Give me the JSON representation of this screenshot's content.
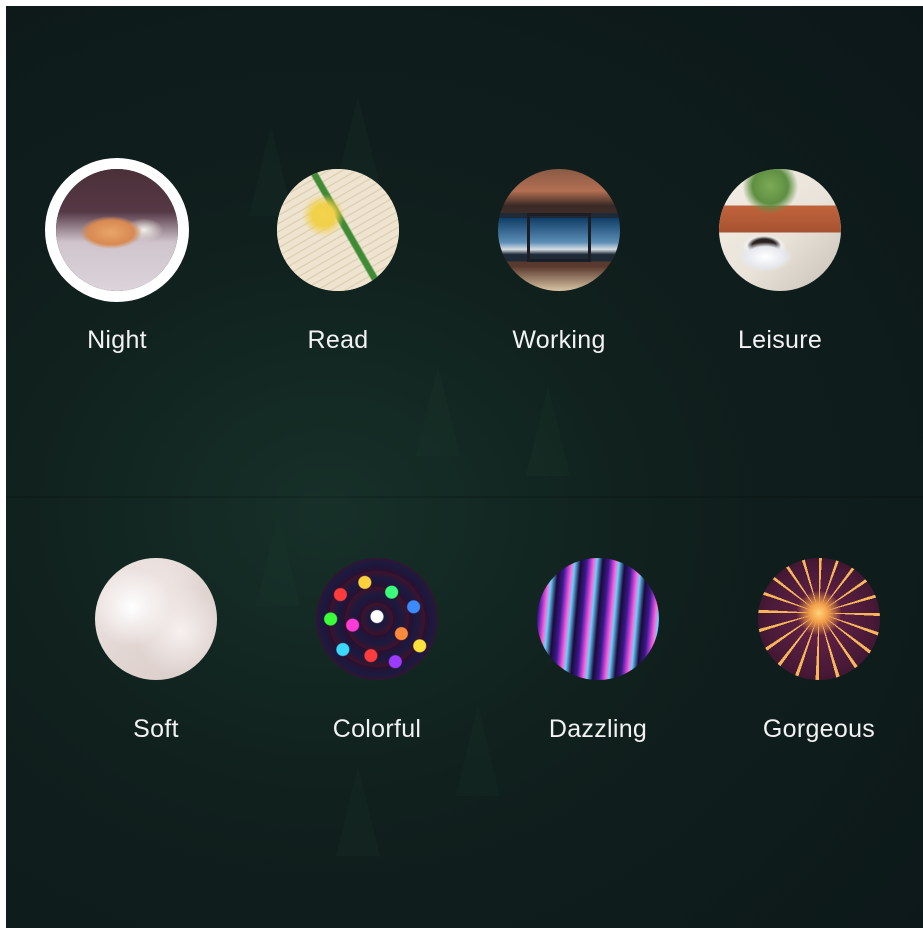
{
  "scene_modes": [
    {
      "label": "Night",
      "icon": "sleeping-cat-icon",
      "selected": true
    },
    {
      "label": "Read",
      "icon": "flower-on-book-icon",
      "selected": false
    },
    {
      "label": "Working",
      "icon": "laptop-desk-icon",
      "selected": false
    },
    {
      "label": "Leisure",
      "icon": "coffee-cup-plant-icon",
      "selected": false
    }
  ],
  "light_effects": [
    {
      "label": "Soft",
      "icon": "feathers-icon"
    },
    {
      "label": "Colorful",
      "icon": "bokeh-lights-icon"
    },
    {
      "label": "Dazzling",
      "icon": "light-trails-icon"
    },
    {
      "label": "Gorgeous",
      "icon": "fireworks-icon"
    }
  ],
  "colors": {
    "background": "#10201d",
    "label_text": "#f2f2f2",
    "selected_ring": "#ffffff"
  }
}
